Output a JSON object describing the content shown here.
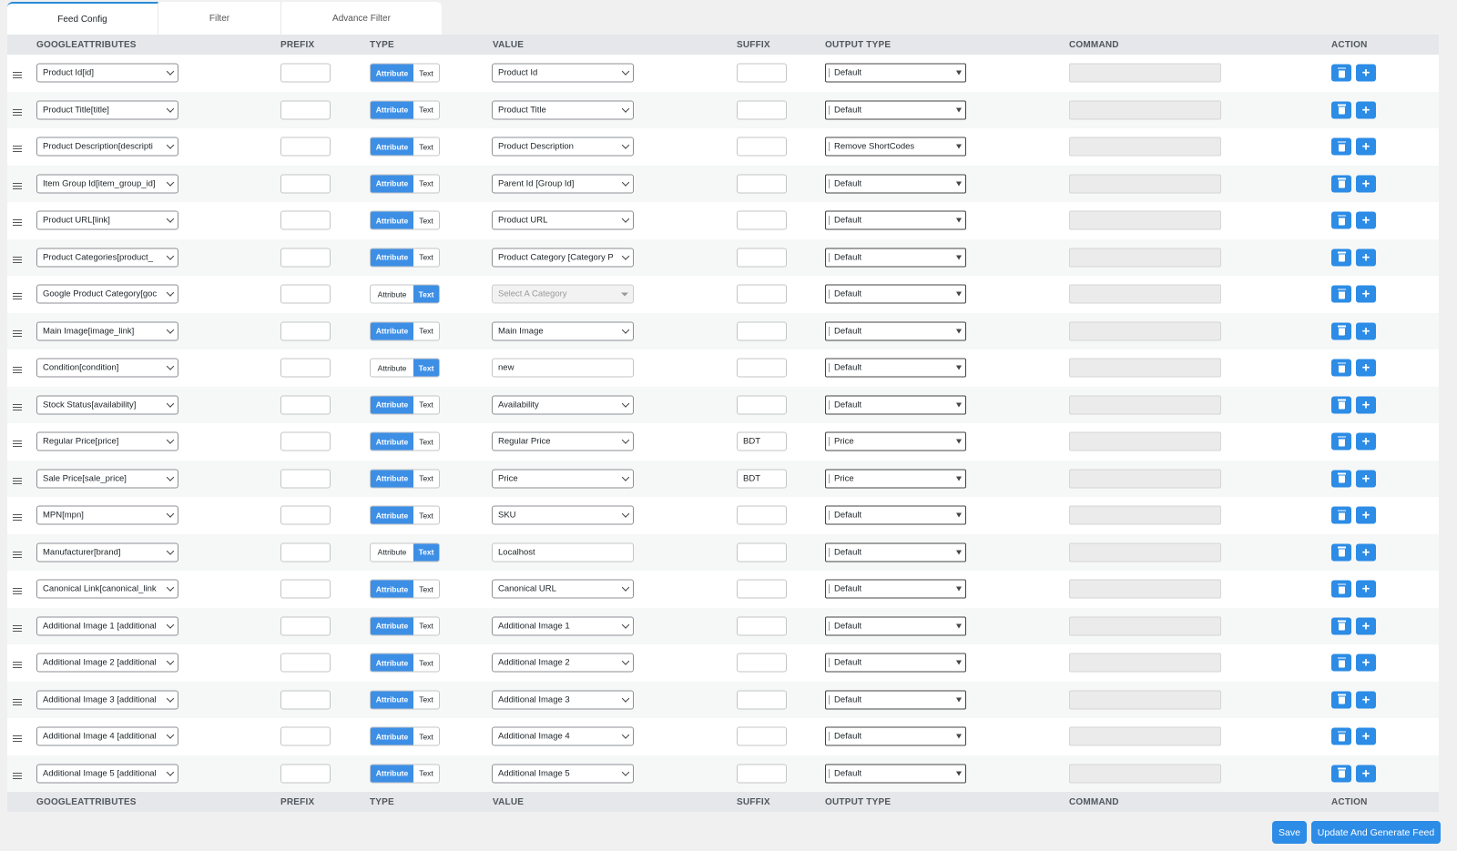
{
  "tabs": [
    "Feed Config",
    "Filter",
    "Advance Filter"
  ],
  "columns": [
    "GOOGLEATTRIBUTES",
    "PREFIX",
    "TYPE",
    "VALUE",
    "SUFFIX",
    "OUTPUT TYPE",
    "COMMAND",
    "ACTION"
  ],
  "type_labels": {
    "attribute": "Attribute",
    "text": "Text"
  },
  "rows": [
    {
      "attribute": "Product Id[id]",
      "type": "attribute",
      "value": "Product Id",
      "suffix": "",
      "output": "Default"
    },
    {
      "attribute": "Product Title[title]",
      "type": "attribute",
      "value": "Product Title",
      "suffix": "",
      "output": "Default"
    },
    {
      "attribute": "Product Description[descripti",
      "type": "attribute",
      "value": "Product Description",
      "suffix": "",
      "output": "Remove ShortCodes"
    },
    {
      "attribute": "Item Group Id[item_group_id]",
      "type": "attribute",
      "value": "Parent Id [Group Id]",
      "suffix": "",
      "output": "Default"
    },
    {
      "attribute": "Product URL[link]",
      "type": "attribute",
      "value": "Product URL",
      "suffix": "",
      "output": "Default"
    },
    {
      "attribute": "Product Categories[product_",
      "type": "attribute",
      "value": "Product Category [Category P",
      "suffix": "",
      "output": "Default"
    },
    {
      "attribute": "Google Product Category[goc",
      "type": "text",
      "value": "Select A Category",
      "value_kind": "category",
      "suffix": "",
      "output": "Default"
    },
    {
      "attribute": "Main Image[image_link]",
      "type": "attribute",
      "value": "Main Image",
      "suffix": "",
      "output": "Default"
    },
    {
      "attribute": "Condition[condition]",
      "type": "text",
      "value": "new",
      "suffix": "",
      "output": "Default"
    },
    {
      "attribute": "Stock Status[availability]",
      "type": "attribute",
      "value": "Availability",
      "suffix": "",
      "output": "Default"
    },
    {
      "attribute": "Regular Price[price]",
      "type": "attribute",
      "value": "Regular Price",
      "suffix": "BDT",
      "output": "Price"
    },
    {
      "attribute": "Sale Price[sale_price]",
      "type": "attribute",
      "value": "Price",
      "suffix": "BDT",
      "output": "Price"
    },
    {
      "attribute": "MPN[mpn]",
      "type": "attribute",
      "value": "SKU",
      "suffix": "",
      "output": "Default"
    },
    {
      "attribute": "Manufacturer[brand]",
      "type": "text",
      "value": "Localhost",
      "suffix": "",
      "output": "Default"
    },
    {
      "attribute": "Canonical Link[canonical_link",
      "type": "attribute",
      "value": "Canonical URL",
      "suffix": "",
      "output": "Default"
    },
    {
      "attribute": "Additional Image 1 [additional",
      "type": "attribute",
      "value": "Additional Image 1",
      "suffix": "",
      "output": "Default"
    },
    {
      "attribute": "Additional Image 2 [additional",
      "type": "attribute",
      "value": "Additional Image 2",
      "suffix": "",
      "output": "Default"
    },
    {
      "attribute": "Additional Image 3 [additional",
      "type": "attribute",
      "value": "Additional Image 3",
      "suffix": "",
      "output": "Default"
    },
    {
      "attribute": "Additional Image 4 [additional",
      "type": "attribute",
      "value": "Additional Image 4",
      "suffix": "",
      "output": "Default"
    },
    {
      "attribute": "Additional Image 5 [additional",
      "type": "attribute",
      "value": "Additional Image 5",
      "suffix": "",
      "output": "Default"
    }
  ],
  "buttons": {
    "save": "Save",
    "update": "Update And Generate Feed"
  },
  "colors": {
    "accent": "#2c8ce6",
    "header_bg": "#e5e7ea",
    "page_bg": "#f0f0f1"
  },
  "icons": {
    "drag": "drag-handle-icon",
    "delete": "trash-icon",
    "add": "plus-icon",
    "select": "chevron-down-icon"
  }
}
